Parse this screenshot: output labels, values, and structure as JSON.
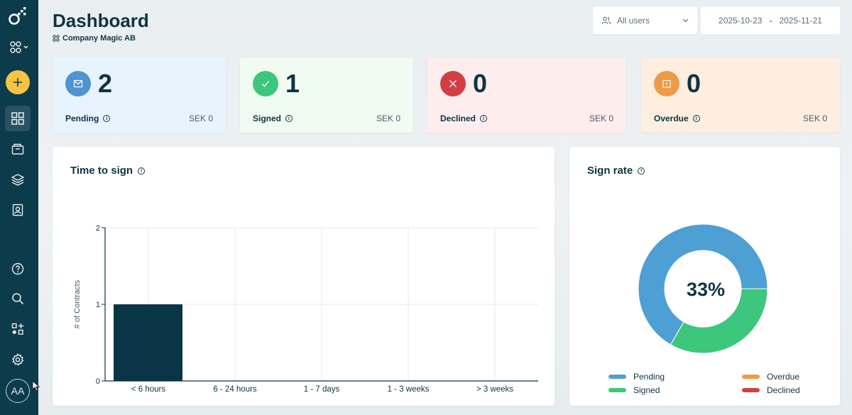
{
  "header": {
    "title": "Dashboard",
    "company": "Company Magic AB",
    "users_filter": "All users",
    "date_from": "2025-10-23",
    "date_separator": "-",
    "date_to": "2025-11-21"
  },
  "sidebar": {
    "avatar_initials": "AA",
    "items": [
      {
        "icon": "logo-icon"
      },
      {
        "icon": "workspace-switch-icon"
      },
      {
        "icon": "plus-icon"
      },
      {
        "icon": "dashboard-grid-icon",
        "active": true
      },
      {
        "icon": "folder-icon"
      },
      {
        "icon": "layers-icon"
      },
      {
        "icon": "contacts-icon"
      },
      {
        "icon": "help-icon"
      },
      {
        "icon": "search-icon"
      },
      {
        "icon": "apps-icon"
      },
      {
        "icon": "settings-icon"
      }
    ]
  },
  "stats": [
    {
      "label": "Pending",
      "count": "2",
      "amount": "SEK 0",
      "bg": "#e8f4fd",
      "icon_color": "#4e94d1",
      "icon": "envelope-icon"
    },
    {
      "label": "Signed",
      "count": "1",
      "amount": "SEK 0",
      "bg": "#f0fbf1",
      "icon_color": "#3cc77c",
      "icon": "check-icon"
    },
    {
      "label": "Declined",
      "count": "0",
      "amount": "SEK 0",
      "bg": "#fdeded",
      "icon_color": "#d33e45",
      "icon": "x-icon"
    },
    {
      "label": "Overdue",
      "count": "0",
      "amount": "SEK 0",
      "bg": "#fdeee0",
      "icon_color": "#ee9b48",
      "icon": "calendar-icon"
    }
  ],
  "time_to_sign": {
    "title": "Time to sign"
  },
  "sign_rate": {
    "title": "Sign rate",
    "center_label": "33%",
    "legend": [
      {
        "label": "Pending",
        "color": "#4e9fd3"
      },
      {
        "label": "Overdue",
        "color": "#ee9b48"
      },
      {
        "label": "Signed",
        "color": "#3cc77c"
      },
      {
        "label": "Declined",
        "color": "#d33e45"
      }
    ]
  },
  "chart_data": [
    {
      "type": "bar",
      "title": "Time to sign",
      "xlabel": "",
      "ylabel": "# of Contracts",
      "categories": [
        "< 6 hours",
        "6 - 24 hours",
        "1 - 7 days",
        "1 - 3 weeks",
        "> 3 weeks"
      ],
      "values": [
        1,
        0,
        0,
        0,
        0
      ],
      "ylim": [
        0,
        2
      ],
      "yticks": [
        0,
        1,
        2
      ],
      "grid": true,
      "color": "#0a3546"
    },
    {
      "type": "pie",
      "title": "Sign rate",
      "categories": [
        "Pending",
        "Signed",
        "Overdue",
        "Declined"
      ],
      "values": [
        2,
        1,
        0,
        0
      ],
      "colors": [
        "#4e9fd3",
        "#3cc77c",
        "#ee9b48",
        "#d33e45"
      ],
      "center_label": "33%",
      "legend": "bottom"
    }
  ]
}
